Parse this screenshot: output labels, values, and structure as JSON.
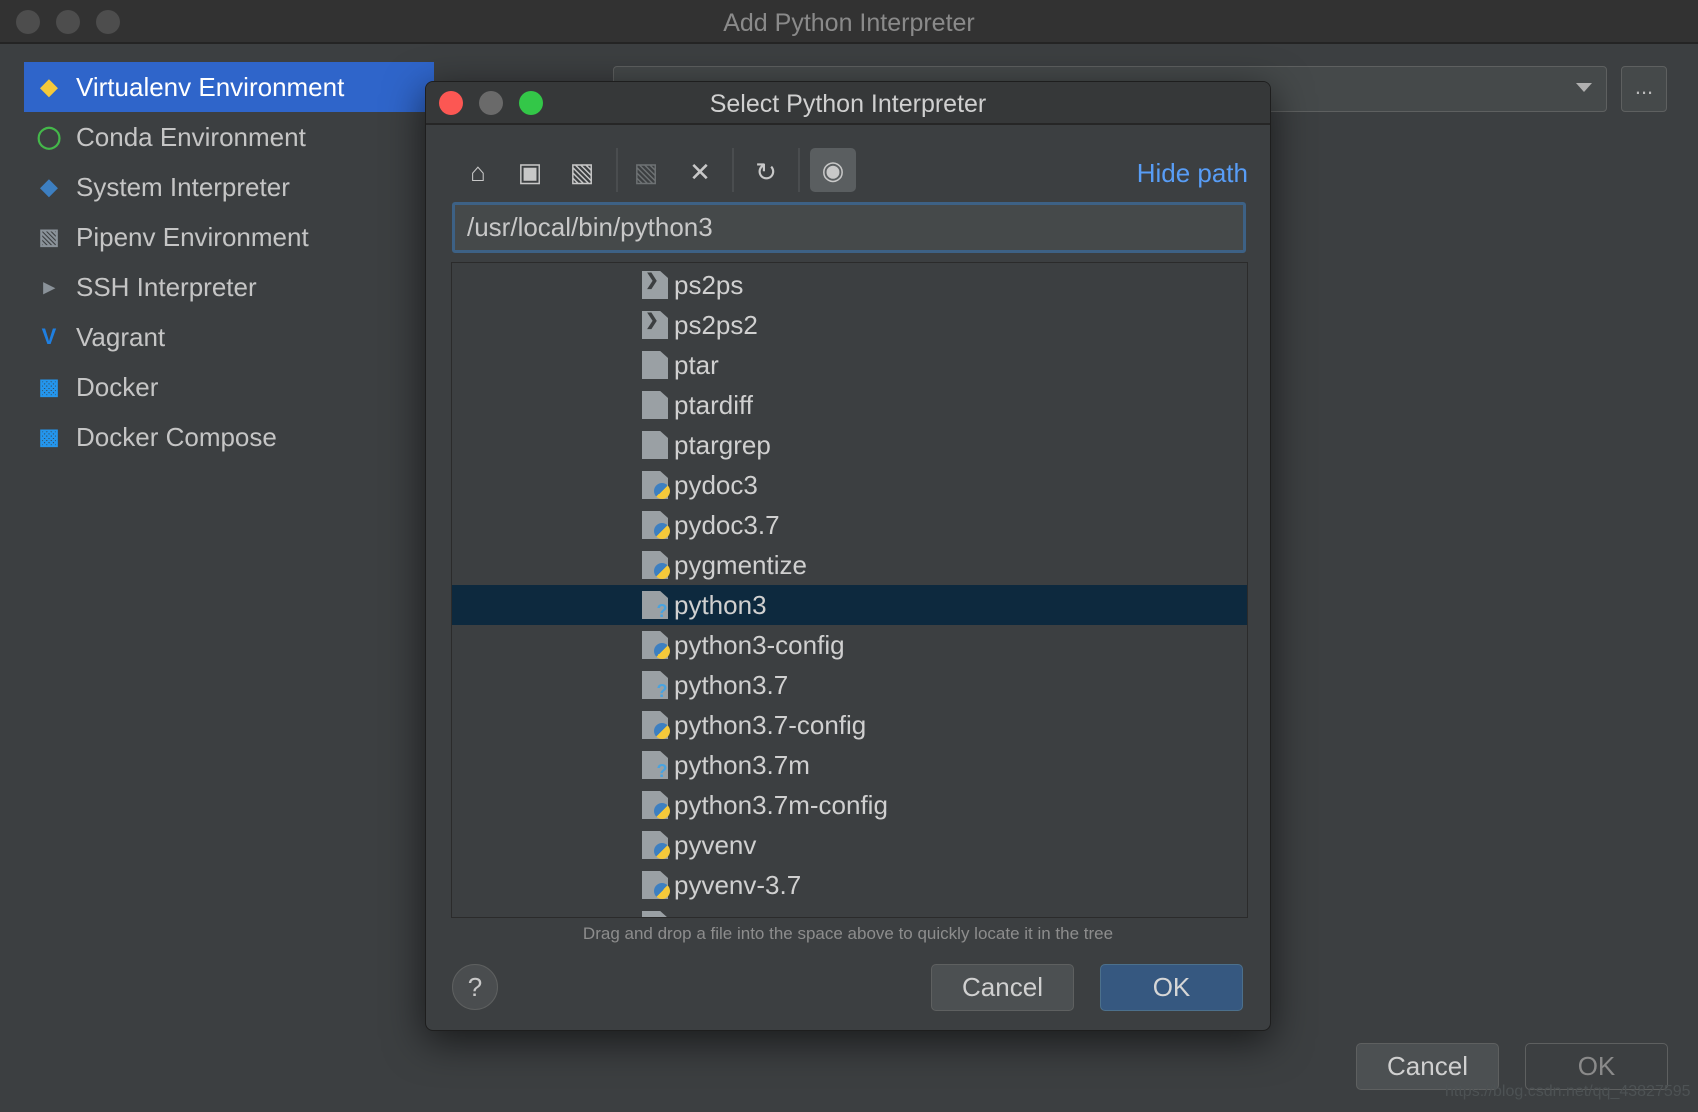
{
  "window": {
    "title": "Add Python Interpreter"
  },
  "sidebar": {
    "items": [
      {
        "label": "Virtualenv Environment",
        "icon": "python-virtualenv-icon",
        "selected": true
      },
      {
        "label": "Conda Environment",
        "icon": "conda-icon"
      },
      {
        "label": "System Interpreter",
        "icon": "python-icon"
      },
      {
        "label": "Pipenv Environment",
        "icon": "pipenv-icon"
      },
      {
        "label": "SSH Interpreter",
        "icon": "ssh-terminal-icon"
      },
      {
        "label": "Vagrant",
        "icon": "vagrant-icon"
      },
      {
        "label": "Docker",
        "icon": "docker-icon"
      },
      {
        "label": "Docker Compose",
        "icon": "docker-compose-icon"
      }
    ]
  },
  "main": {
    "browse_label": "..."
  },
  "dialog": {
    "title": "Select Python Interpreter",
    "hide_path": "Hide path",
    "path": "/usr/local/bin/python3",
    "toolbar": [
      "home-icon",
      "desktop-icon",
      "project-folder-icon",
      "new-folder-icon",
      "delete-icon",
      "refresh-icon",
      "show-hidden-icon"
    ],
    "files": [
      {
        "name": "ps2ps",
        "type": "script"
      },
      {
        "name": "ps2ps2",
        "type": "script"
      },
      {
        "name": "ptar",
        "type": "text"
      },
      {
        "name": "ptardiff",
        "type": "text"
      },
      {
        "name": "ptargrep",
        "type": "text"
      },
      {
        "name": "pydoc3",
        "type": "python"
      },
      {
        "name": "pydoc3.7",
        "type": "python"
      },
      {
        "name": "pygmentize",
        "type": "python"
      },
      {
        "name": "python3",
        "type": "unknown",
        "selected": true
      },
      {
        "name": "python3-config",
        "type": "python"
      },
      {
        "name": "python3.7",
        "type": "unknown"
      },
      {
        "name": "python3.7-config",
        "type": "python"
      },
      {
        "name": "python3.7m",
        "type": "unknown"
      },
      {
        "name": "python3.7m-config",
        "type": "python"
      },
      {
        "name": "pyvenv",
        "type": "python"
      },
      {
        "name": "pyvenv-3.7",
        "type": "python"
      }
    ],
    "hint": "Drag and drop a file into the space above to quickly locate it in the tree",
    "help": "?",
    "cancel": "Cancel",
    "ok": "OK"
  },
  "footer": {
    "cancel": "Cancel",
    "ok": "OK"
  },
  "watermark": "https://blog.csdn.net/qq_43827595",
  "colors": {
    "accent": "#2f65ca",
    "link": "#589df6",
    "selection": "#0d293e",
    "default_button": "#365880"
  }
}
